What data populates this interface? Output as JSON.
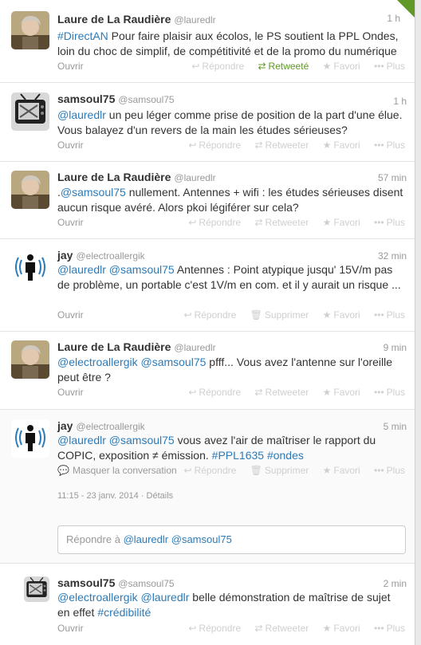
{
  "actions": {
    "open": "Ouvrir",
    "reply": "Répondre",
    "retweet": "Retweeter",
    "retweeted": "Retweeté",
    "delete": "Supprimer",
    "favorite": "Favori",
    "more": "Plus",
    "hide_conversation": "Masquer la conversation",
    "details": "Détails"
  },
  "tweets": [
    {
      "name": "Laure de La Raudière",
      "handle": "@lauredlr",
      "time": "1 h",
      "t1": "#DirectAN",
      "t2": " Pour faire plaisir aux écolos, le PS soutient la PPL Ondes, loin du choc de simplif, de compétitivité et de la promo du numérique"
    },
    {
      "name": "samsoul75",
      "handle": "@samsoul75",
      "time": "1 h",
      "t1": "@lauredlr",
      "t2": " un peu léger comme prise de position de la part d'une élue.  Vous balayez d'un revers de la main les études sérieuses?"
    },
    {
      "name": "Laure de La Raudière",
      "handle": "@lauredlr",
      "time": "57 min",
      "t0": ".",
      "t1": "@samsoul75",
      "t2": " nullement. Antennes + wifi : les études sérieuses disent aucun risque avéré. Alors pkoi légiférer sur cela?"
    },
    {
      "name": "jay",
      "handle": "@electroallergik",
      "time": "32 min",
      "t1": "@lauredlr",
      "t1b": " ",
      "t1c": "@samsoul75",
      "t2": " Antennes : Point atypique jusqu' 15V/m pas de problème, un portable c'est 1V/m en com.  et il y aurait un risque ..."
    },
    {
      "name": "Laure de La Raudière",
      "handle": "@lauredlr",
      "time": "9 min",
      "t1": "@electroallergik",
      "t1b": " ",
      "t1c": "@samsoul75",
      "t2": " pfff... Vous avez l'antenne sur l'oreille peut être ?"
    },
    {
      "name": "jay",
      "handle": "@electroallergik",
      "time": "5 min",
      "t1": "@lauredlr",
      "t1b": " ",
      "t1c": "@samsoul75",
      "t2": " vous avez l'air de maîtriser le rapport du COPIC, exposition ≠ émission. ",
      "t3": "#PPL1635",
      "t3b": " ",
      "t3c": "#ondes",
      "timestamp": "11:15 - 23 janv. 2014",
      "sep": "·"
    },
    {
      "name": "samsoul75",
      "handle": "@samsoul75",
      "time": "2 min",
      "t1": "@electroallergik",
      "t1b": " ",
      "t1c": "@lauredlr",
      "t2": " belle démonstration de maîtrise de sujet en effet ",
      "t3": "#crédibilité"
    }
  ],
  "reply_box": {
    "prefix": "Répondre à ",
    "m1": "@lauredlr",
    "sp": " ",
    "m2": "@samsoul75"
  },
  "colors": {
    "link": "#2b7bb9",
    "retweeted": "#609928",
    "muted": "#999999"
  }
}
